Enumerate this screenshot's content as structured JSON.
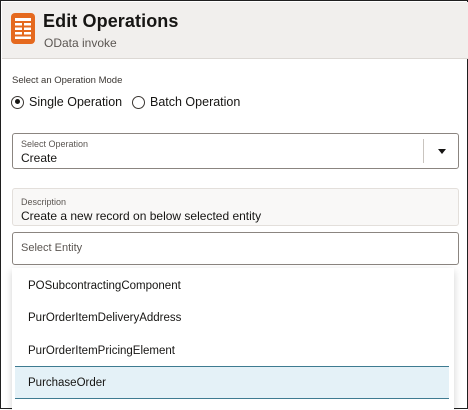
{
  "header": {
    "title": "Edit Operations",
    "subtitle": "OData invoke",
    "icon": "table-form-icon",
    "icon_color": "#e5691e"
  },
  "mode": {
    "label": "Select an Operation Mode",
    "options": [
      {
        "label": "Single Operation",
        "checked": true
      },
      {
        "label": "Batch Operation",
        "checked": false
      }
    ]
  },
  "operation": {
    "label": "Select Operation",
    "value": "Create"
  },
  "description": {
    "label": "Description",
    "value": "Create a new record on below selected entity"
  },
  "entity": {
    "placeholder": "Select Entity",
    "options": [
      "POSubcontractingComponent",
      "PurOrderItemDeliveryAddress",
      "PurOrderItemPricingElement",
      "PurchaseOrder"
    ],
    "highlighted": "PurchaseOrder",
    "highlight_color": "#e4f1f7"
  }
}
